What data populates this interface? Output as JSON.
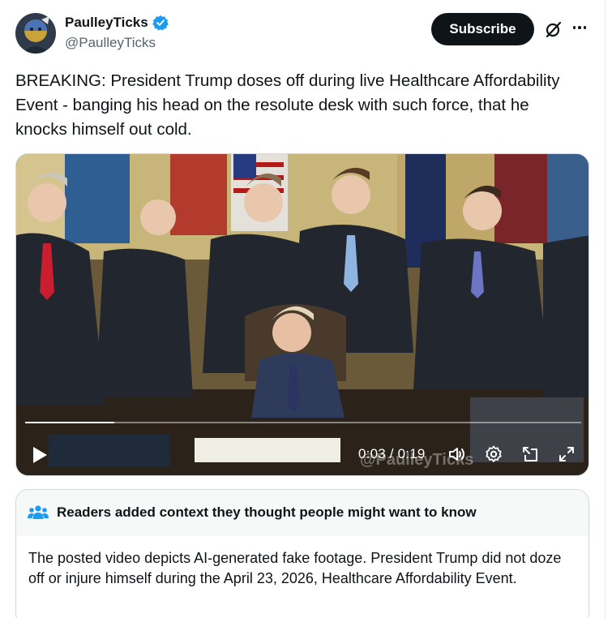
{
  "author": {
    "display_name": "PaulleyTicks",
    "handle": "@PaulleyTicks",
    "verified": true,
    "verified_color": "#1d9bf0"
  },
  "actions": {
    "subscribe_label": "Subscribe",
    "grok_icon": "grok-icon",
    "more_icon": "more-icon"
  },
  "post": {
    "text": "BREAKING: President Trump doses off during live Healthcare Affordability Event - banging his head on the resolute desk with such force, that he knocks himself out cold."
  },
  "video": {
    "current_time": "0:03",
    "duration": "0:19",
    "time_display": "0:03 / 0:19",
    "progress": 0.16,
    "watermark": "@PaulleyTicks",
    "controls": [
      "play-icon",
      "volume-icon",
      "settings-icon",
      "pip-icon",
      "fullscreen-icon"
    ]
  },
  "community_note": {
    "title": "Readers added context they thought people might want to know",
    "icon": "people-icon",
    "icon_color": "#1d9bf0",
    "body": "The posted video depicts AI-generated fake footage. President Trump did not doze off or injure himself during the April 23, 2026, Healthcare Affordability Event."
  }
}
